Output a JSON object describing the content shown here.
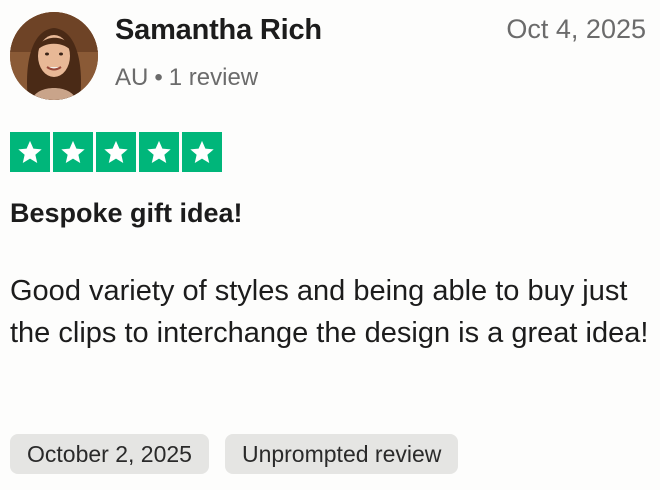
{
  "reviewer": {
    "name": "Samantha Rich",
    "country": "AU",
    "separator": "•",
    "review_count": "1 review",
    "avatar_icon": "person-photo"
  },
  "review": {
    "posted_date": "Oct 4, 2025",
    "rating": 5,
    "rating_max": 5,
    "star_color": "#00b67a",
    "title": "Bespoke gift idea!",
    "text": "Good variety of styles and being able to buy just the clips to interchange the design is a great idea!"
  },
  "chips": [
    {
      "label": "October 2, 2025"
    },
    {
      "label": "Unprompted review"
    }
  ]
}
